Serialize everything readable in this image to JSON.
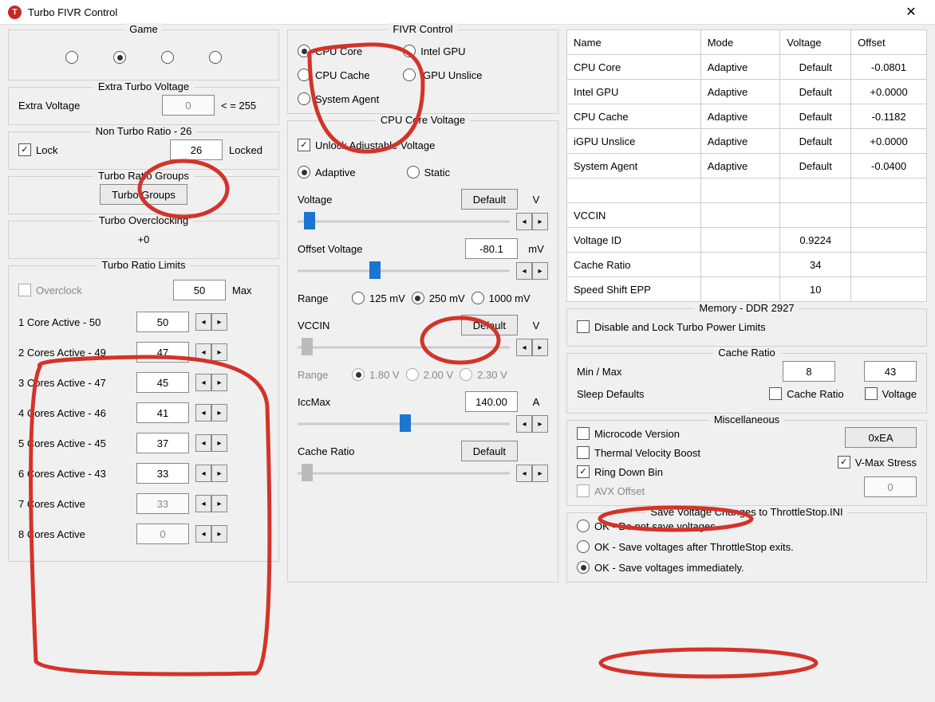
{
  "title": "Turbo FIVR Control",
  "gameGroup": {
    "legend": "Game"
  },
  "extraTurbo": {
    "legend": "Extra Turbo Voltage",
    "label": "Extra Voltage",
    "value": "0",
    "suffix": "< = 255"
  },
  "nonTurbo": {
    "legend": "Non Turbo Ratio - 26",
    "lock": "Lock",
    "value": "26",
    "state": "Locked"
  },
  "ratioGroups": {
    "legend": "Turbo Ratio Groups",
    "btn": "Turbo Groups"
  },
  "overclock": {
    "legend": "Turbo Overclocking",
    "value": "+0"
  },
  "limits": {
    "legend": "Turbo Ratio Limits",
    "oc": "Overclock",
    "ocVal": "50",
    "maxLbl": "Max",
    "rows": [
      {
        "label": "1 Core  Active - 50",
        "val": "50",
        "en": true
      },
      {
        "label": "2 Cores Active - 49",
        "val": "47",
        "en": true
      },
      {
        "label": "3 Cores Active - 47",
        "val": "45",
        "en": true
      },
      {
        "label": "4 Cores Active - 46",
        "val": "41",
        "en": true
      },
      {
        "label": "5 Cores Active - 45",
        "val": "37",
        "en": true
      },
      {
        "label": "6 Cores Active - 43",
        "val": "33",
        "en": true
      },
      {
        "label": "7 Cores Active",
        "val": "33",
        "en": false
      },
      {
        "label": "8 Cores Active",
        "val": "0",
        "en": false
      }
    ]
  },
  "fivr": {
    "legend": "FIVR Control",
    "opts": [
      "CPU Core",
      "CPU Cache",
      "System Agent",
      "Intel GPU",
      "iGPU Unslice"
    ]
  },
  "coreV": {
    "legend": "CPU Core Voltage",
    "unlock": "Unlock Adjustable Voltage",
    "adaptive": "Adaptive",
    "static": "Static",
    "voltageLbl": "Voltage",
    "defaultBtn": "Default",
    "vUnit": "V",
    "offsetLbl": "Offset Voltage",
    "offsetVal": "-80.1",
    "mv": "mV",
    "rangeLbl": "Range",
    "r125": "125 mV",
    "r250": "250 mV",
    "r1000": "1000 mV",
    "vccinLbl": "VCCIN",
    "vccinBtn": "Default",
    "vrange": "Range",
    "v18": "1.80 V",
    "v20": "2.00 V",
    "v23": "2.30 V",
    "iccLbl": "IccMax",
    "iccVal": "140.00",
    "aUnit": "A",
    "cacheLbl": "Cache Ratio",
    "cacheBtn": "Default"
  },
  "table": {
    "head": [
      "Name",
      "Mode",
      "Voltage",
      "Offset"
    ],
    "rows": [
      [
        "CPU Core",
        "Adaptive",
        "Default",
        "-0.0801"
      ],
      [
        "Intel GPU",
        "Adaptive",
        "Default",
        "+0.0000"
      ],
      [
        "CPU Cache",
        "Adaptive",
        "Default",
        "-0.1182"
      ],
      [
        "iGPU Unslice",
        "Adaptive",
        "Default",
        "+0.0000"
      ],
      [
        "System Agent",
        "Adaptive",
        "Default",
        "-0.0400"
      ]
    ],
    "extra": [
      [
        "VCCIN",
        "",
        "",
        ""
      ],
      [
        "Voltage ID",
        "",
        "0.9224",
        ""
      ],
      [
        "Cache Ratio",
        "",
        "34",
        ""
      ],
      [
        "Speed Shift EPP",
        "",
        "10",
        ""
      ]
    ]
  },
  "mem": {
    "legend": "Memory - DDR 2927",
    "lockLbl": "Disable and Lock Turbo Power Limits"
  },
  "cache": {
    "legend": "Cache Ratio",
    "minmax": "Min / Max",
    "min": "8",
    "max": "43",
    "sleep": "Sleep Defaults",
    "cacheCb": "Cache Ratio",
    "voltCb": "Voltage"
  },
  "misc": {
    "legend": "Miscellaneous",
    "micro": "Microcode Version",
    "microVal": "0xEA",
    "tvb": "Thermal Velocity Boost",
    "vmax": "V-Max Stress",
    "ring": "Ring Down Bin",
    "avx": "AVX Offset",
    "avxVal": "0"
  },
  "save": {
    "legend": "Save Voltage Changes to ThrottleStop.INI",
    "o1": "OK - Do not save voltages.",
    "o2": "OK - Save voltages after ThrottleStop exits.",
    "o3": "OK - Save voltages immediately."
  }
}
